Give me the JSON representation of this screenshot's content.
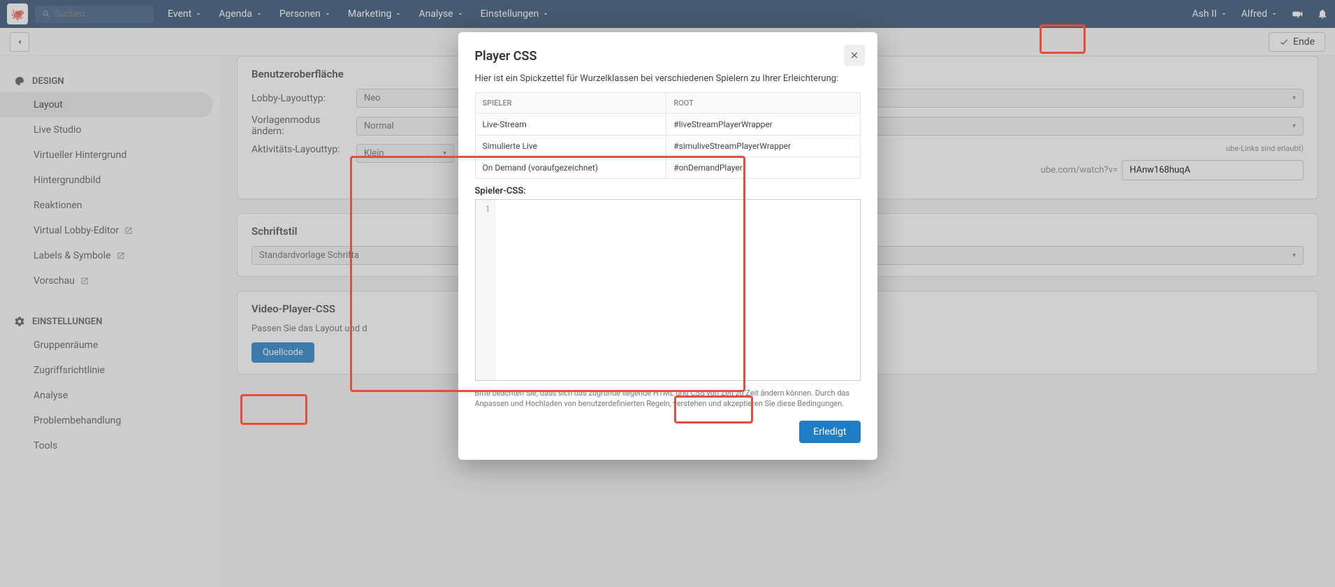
{
  "topnav": {
    "search_placeholder": "Suchen",
    "items": [
      "Event",
      "Agenda",
      "Personen",
      "Marketing",
      "Analyse",
      "Einstellungen"
    ],
    "right": {
      "user1": "Ash II",
      "user2": "Alfred"
    }
  },
  "subbar": {
    "ende": "Ende"
  },
  "sidebar": {
    "design_header": "DESIGN",
    "design_items": [
      "Layout",
      "Live Studio",
      "Virtueller Hintergrund",
      "Hintergrundbild",
      "Reaktionen",
      "Virtual Lobby-Editor",
      "Labels & Symbole",
      "Vorschau"
    ],
    "settings_header": "EINSTELLUNGEN",
    "settings_items": [
      "Gruppenräume",
      "Zugriffsrichtlinie",
      "Analyse",
      "Problembehandlung",
      "Tools"
    ]
  },
  "main": {
    "card1": {
      "title": "Benutzeroberfläche",
      "label1": "Lobby-Layouttyp:",
      "val1": "Neo",
      "label2": "Vorlagenmodus ändern:",
      "val2": "Normal",
      "label3": "Aktivitäts-Layouttyp:",
      "val3": "Klein",
      "hint": "ube-Links sind erlaubt)",
      "url_prefix": "ube.com/watch?v=",
      "url_value": "HAnw168huqA"
    },
    "card2": {
      "title": "Schriftstil",
      "val": "Standardvorlage Schrifta"
    },
    "card3": {
      "title": "Video-Player-CSS",
      "desc": "Passen Sie das Layout und d",
      "button": "Quellcode"
    }
  },
  "modal": {
    "title": "Player CSS",
    "intro": "Hier ist ein Spickzettel für Wurzelklassen bei verschiedenen Spielern zu Ihrer Erleichterung:",
    "th1": "SPIELER",
    "th2": "ROOT",
    "rows": [
      {
        "player": "Live-Stream",
        "root": "#liveStreamPlayerWrapper"
      },
      {
        "player": "Simulierte Live",
        "root": "#simuliveStreamPlayerWrapper"
      },
      {
        "player": "On Demand (voraufgezeichnet)",
        "root": "#onDemandPlayer"
      }
    ],
    "editor_label": "Spieler-CSS:",
    "line_no": "1",
    "note": "Bitte beachten Sie, dass sich das zugrunde liegende HTML und CSS von Zeit zu Zeit ändern können. Durch das Anpassen und Hochladen von benutzerdefinierten Regeln, verstehen und akzeptieren Sie diese Bedingungen.",
    "done": "Erledigt"
  }
}
